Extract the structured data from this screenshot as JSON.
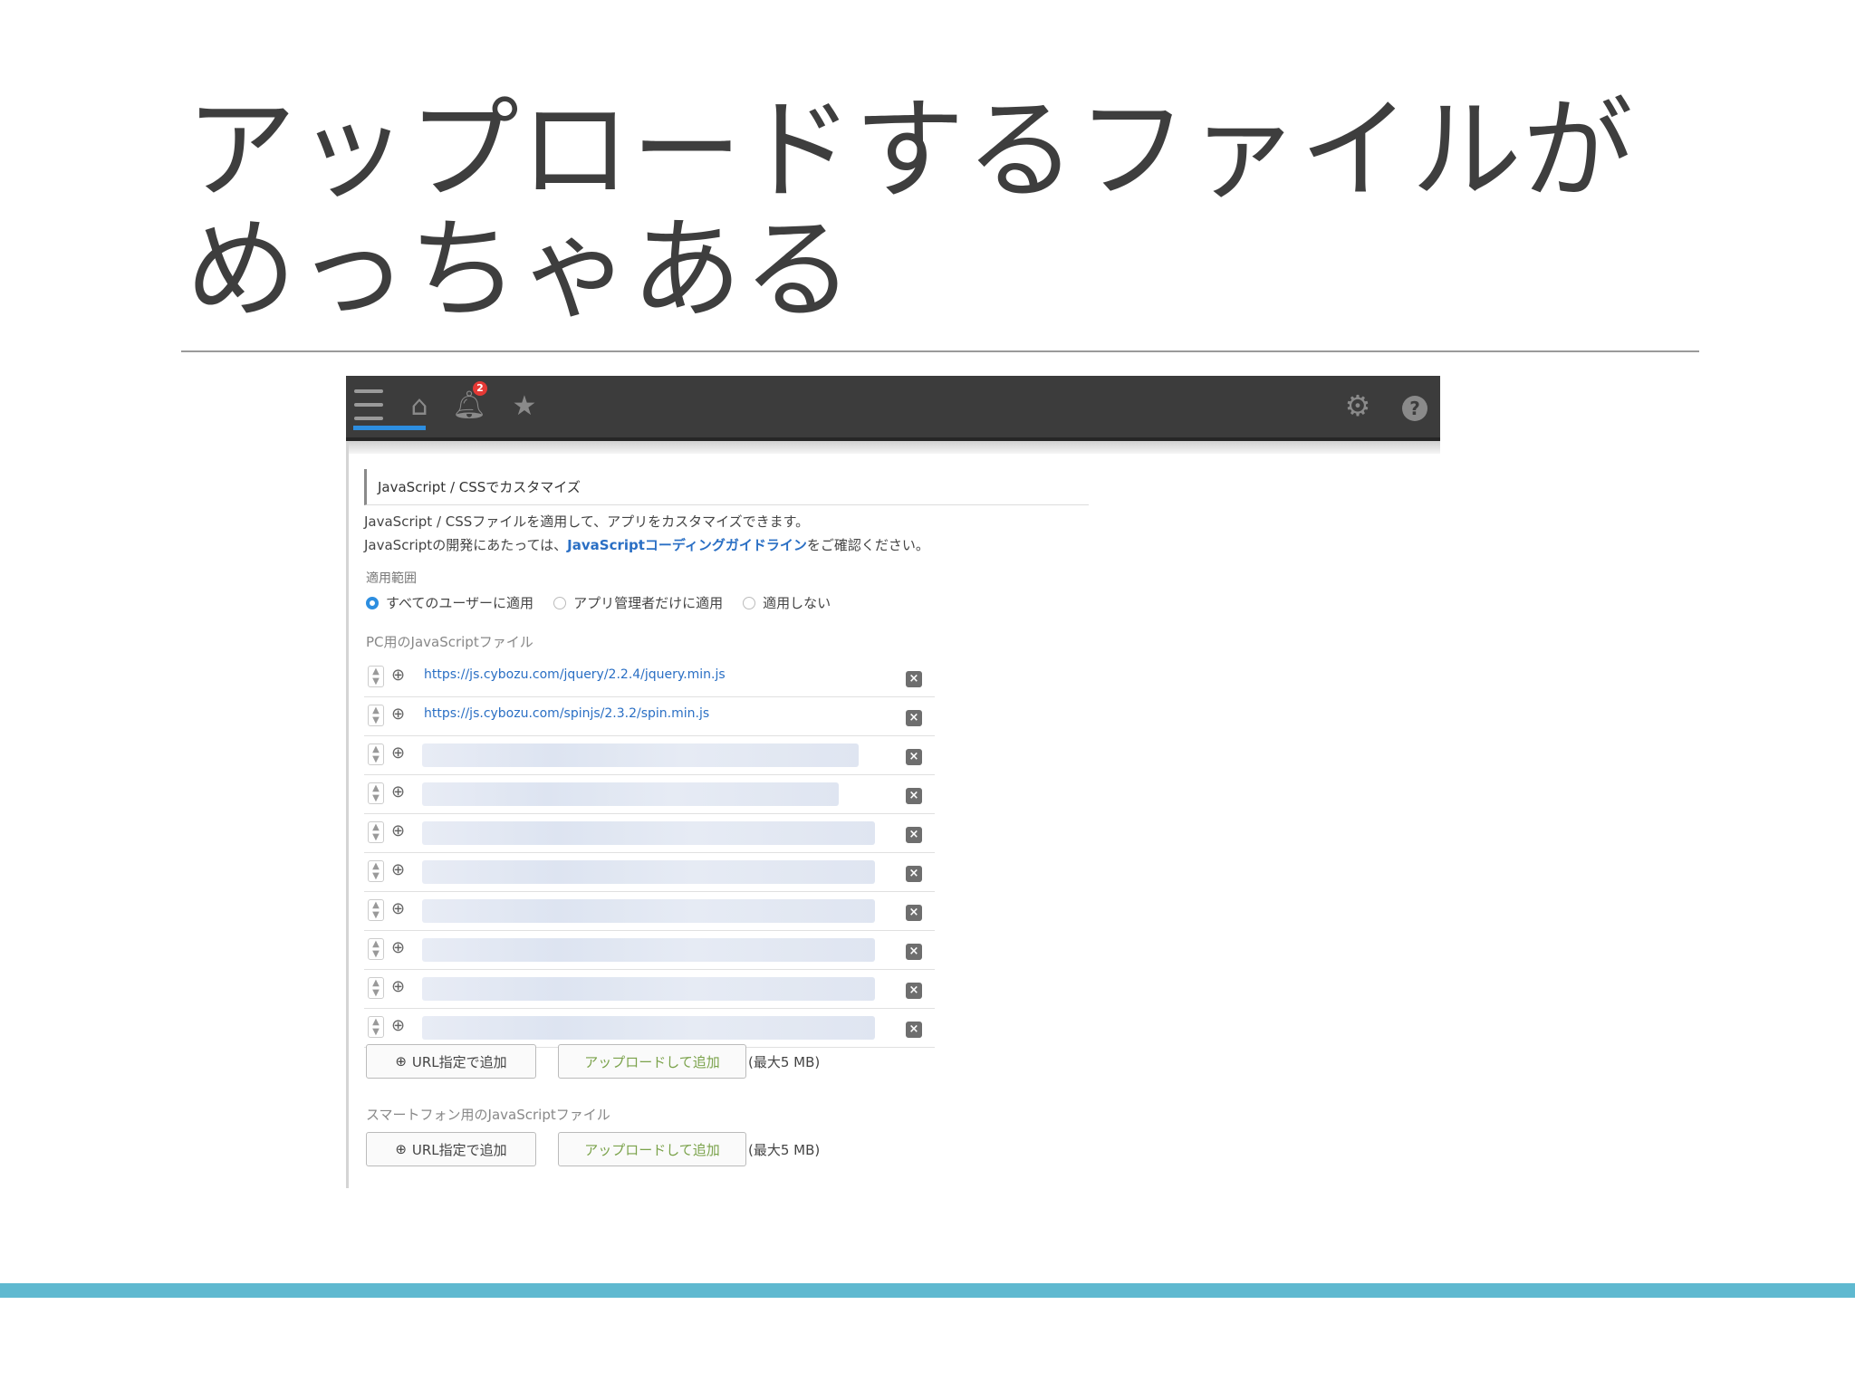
{
  "slide": {
    "title_line1": "アップロードするファイルが",
    "title_line2": "めっちゃある"
  },
  "topbar": {
    "notification_count": "2"
  },
  "section": {
    "heading": "JavaScript / CSSでカスタマイズ",
    "desc_line1": "JavaScript / CSSファイルを適用して、アプリをカスタマイズできます。",
    "desc_line2_prefix": "JavaScriptの開発にあたっては、",
    "desc_line2_link": "JavaScriptコーディングガイドライン",
    "desc_line2_suffix": "をご確認ください。"
  },
  "scope": {
    "label": "適用範囲",
    "options": [
      "すべてのユーザーに適用",
      "アプリ管理者だけに適用",
      "適用しない"
    ],
    "selected_index": 0
  },
  "pc_files": {
    "label": "PC用のJavaScriptファイル",
    "urls": [
      "https://js.cybozu.com/jquery/2.2.4/jquery.min.js",
      "https://js.cybozu.com/spinjs/2.3.2/spin.min.js"
    ],
    "blurred_count": 8,
    "add_url_label": "URL指定で追加",
    "upload_label": "アップロードして追加",
    "max_note": "(最大5 MB)"
  },
  "sp_files": {
    "label": "スマートフォン用のJavaScriptファイル",
    "add_url_label": "URL指定で追加",
    "upload_label": "アップロードして追加",
    "max_note": "(最大5 MB)"
  },
  "colors": {
    "accent_bar": "#5fb9d0",
    "link": "#2a6fc4",
    "topbar": "#3c3c3c",
    "radio_selected": "#2d8ee0"
  }
}
